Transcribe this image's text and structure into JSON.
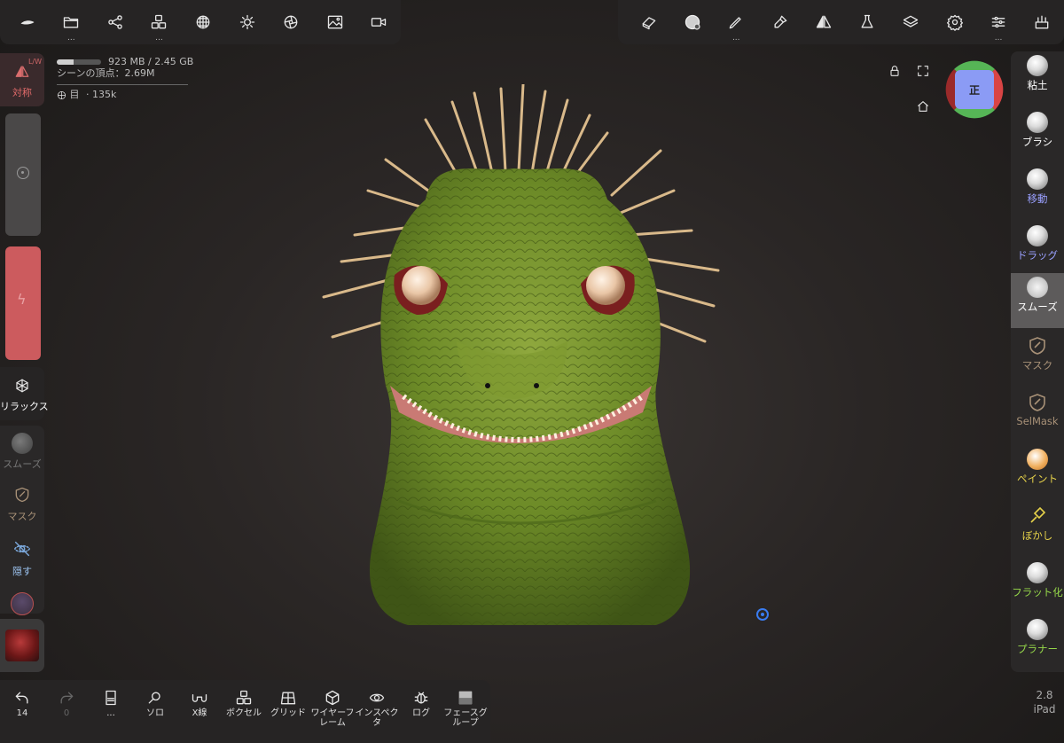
{
  "top_left_toolbar": {
    "items": [
      {
        "name": "logo-icon",
        "dots": ""
      },
      {
        "name": "files-icon",
        "dots": "..."
      },
      {
        "name": "scene-graph-icon",
        "dots": ""
      },
      {
        "name": "cubes-icon",
        "dots": "..."
      },
      {
        "name": "material-sphere-icon",
        "dots": ""
      },
      {
        "name": "lighting-icon",
        "dots": ""
      },
      {
        "name": "camera-aperture-icon",
        "dots": ""
      },
      {
        "name": "background-image-icon",
        "dots": ""
      },
      {
        "name": "video-camera-icon",
        "dots": ""
      }
    ]
  },
  "top_right_toolbar": {
    "items": [
      {
        "name": "eraser-icon",
        "dots": ""
      },
      {
        "name": "smooth-brush-icon",
        "dots": ""
      },
      {
        "name": "stroke-pen-icon",
        "dots": "..."
      },
      {
        "name": "paint-brush-icon",
        "dots": ""
      },
      {
        "name": "symmetry-icon",
        "dots": ""
      },
      {
        "name": "flask-icon",
        "dots": ""
      },
      {
        "name": "layers-icon",
        "dots": ""
      },
      {
        "name": "settings-gear-icon",
        "dots": ""
      },
      {
        "name": "sliders-icon",
        "dots": "..."
      },
      {
        "name": "sculpt-tools-icon",
        "dots": ""
      }
    ]
  },
  "stats": {
    "memory": "923 MB / 2.45 GB",
    "memory_fraction": 0.38,
    "scene_vertices": "シーンの頂点：2.69M",
    "mesh_name": "目",
    "mesh_vertices": "· 135k"
  },
  "left_panel": {
    "symmetry_tag": "L/W",
    "symmetry_label": "対称",
    "relax_label": "リラックス",
    "smooth_label": "スムーズ",
    "mask_label": "マスク",
    "hide_label": "隠す"
  },
  "gizmo": {
    "face_label": "正"
  },
  "right_tools": [
    {
      "label": "粘土",
      "color": "#ffffff",
      "key": "clay"
    },
    {
      "label": "ブラシ",
      "color": "#ffffff",
      "key": "brush"
    },
    {
      "label": "移動",
      "color": "#9aa0ff",
      "key": "move"
    },
    {
      "label": "ドラッグ",
      "color": "#9aa0ff",
      "key": "drag"
    },
    {
      "label": "スムーズ",
      "color": "#ffffff",
      "key": "smooth"
    },
    {
      "label": "マスク",
      "color": "#a89177",
      "key": "mask"
    },
    {
      "label": "SelMask",
      "color": "#a89177",
      "key": "selmask"
    },
    {
      "label": "ペイント",
      "color": "#e6d24a",
      "key": "paint"
    },
    {
      "label": "ぼかし",
      "color": "#e6d24a",
      "key": "smudge"
    },
    {
      "label": "フラット化",
      "color": "#96d84a",
      "key": "flatten"
    },
    {
      "label": "プラナー",
      "color": "#96d84a",
      "key": "planar"
    }
  ],
  "bottom_bar": {
    "undo_count": "14",
    "redo_count": "0",
    "items": [
      {
        "label": "...",
        "icon": "document-icon"
      },
      {
        "label": "ソロ",
        "icon": "search-icon"
      },
      {
        "label": "X線",
        "icon": "xray-glasses-icon"
      },
      {
        "label": "ボクセル",
        "icon": "voxel-icon"
      },
      {
        "label": "グリッド",
        "icon": "grid-icon"
      },
      {
        "label": "ワイヤーフレーム",
        "icon": "wireframe-icon"
      },
      {
        "label": "インスペクタ",
        "icon": "inspector-eye-icon"
      },
      {
        "label": "ログ",
        "icon": "bug-icon"
      },
      {
        "label": "フェースグループ",
        "icon": "face-group-icon"
      }
    ]
  },
  "version": {
    "number": "2.8",
    "device": "iPad"
  },
  "colors": {
    "accent_red": "#cc5b5e",
    "model_green": "#6f8c2a",
    "pivot_blue": "#3a7cf0"
  }
}
